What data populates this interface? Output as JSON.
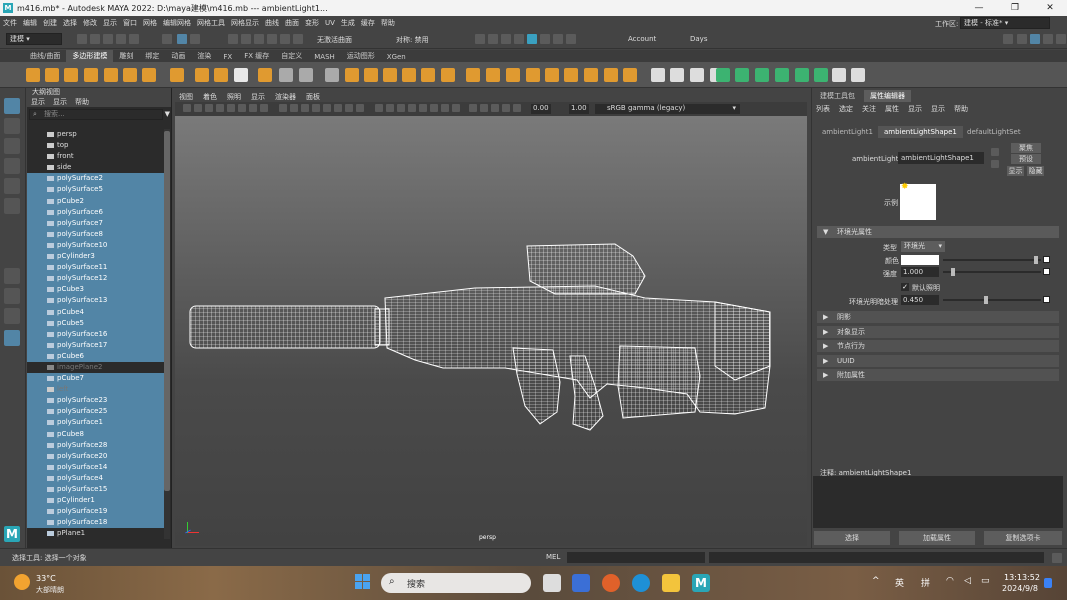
{
  "window": {
    "title": "m416.mb* - Autodesk MAYA 2022: D:\\maya建模\\m416.mb   ---   ambientLight1...",
    "minimize": "—",
    "maximize": "❐",
    "close": "✕"
  },
  "menubar": [
    "文件",
    "编辑",
    "创建",
    "选择",
    "修改",
    "显示",
    "窗口",
    "网格",
    "编辑网格",
    "网格工具",
    "网格显示",
    "曲线",
    "曲面",
    "变形",
    "UV",
    "生成",
    "缓存",
    "帮助"
  ],
  "workspace": {
    "label": "工作区:",
    "value": "建模 - 标准*"
  },
  "statusline": {
    "mode": "建模",
    "no_live_surface": "无激活曲面",
    "symmetry": "对称: 禁用",
    "account": "Account",
    "days": "Days"
  },
  "shelf_tabs": [
    "曲线/曲面",
    "多边形建模",
    "雕刻",
    "绑定",
    "动画",
    "渲染",
    "FX",
    "FX 缓存",
    "自定义",
    "MASH",
    "运动图形",
    "XGen"
  ],
  "shelf_active": 1,
  "outliner": {
    "title": "大纲视图",
    "menus": [
      "显示",
      "显示",
      "帮助"
    ],
    "search_placeholder": "搜索...",
    "items": [
      {
        "name": "persp",
        "kind": "camera",
        "state": "normal"
      },
      {
        "name": "top",
        "kind": "camera",
        "state": "normal"
      },
      {
        "name": "front",
        "kind": "camera",
        "state": "normal"
      },
      {
        "name": "side",
        "kind": "camera",
        "state": "normal"
      },
      {
        "name": "polySurface2",
        "kind": "mesh",
        "state": "sel"
      },
      {
        "name": "polySurface5",
        "kind": "mesh",
        "state": "sel"
      },
      {
        "name": "pCube2",
        "kind": "mesh",
        "state": "sel"
      },
      {
        "name": "polySurface6",
        "kind": "mesh",
        "state": "sel"
      },
      {
        "name": "polySurface7",
        "kind": "mesh",
        "state": "sel"
      },
      {
        "name": "polySurface8",
        "kind": "mesh",
        "state": "sel"
      },
      {
        "name": "polySurface10",
        "kind": "mesh",
        "state": "sel"
      },
      {
        "name": "pCylinder3",
        "kind": "mesh",
        "state": "sel"
      },
      {
        "name": "polySurface11",
        "kind": "mesh",
        "state": "sel"
      },
      {
        "name": "polySurface12",
        "kind": "mesh",
        "state": "sel"
      },
      {
        "name": "pCube3",
        "kind": "mesh",
        "state": "sel"
      },
      {
        "name": "polySurface13",
        "kind": "mesh",
        "state": "sel"
      },
      {
        "name": "pCube4",
        "kind": "mesh",
        "state": "sel"
      },
      {
        "name": "pCube5",
        "kind": "mesh",
        "state": "sel"
      },
      {
        "name": "polySurface16",
        "kind": "mesh",
        "state": "sel"
      },
      {
        "name": "polySurface17",
        "kind": "mesh",
        "state": "sel"
      },
      {
        "name": "pCube6",
        "kind": "mesh",
        "state": "sel"
      },
      {
        "name": "imagePlane2",
        "kind": "image",
        "state": "dim"
      },
      {
        "name": "pCube7",
        "kind": "mesh",
        "state": "selsoft"
      },
      {
        "name": "left",
        "kind": "camera",
        "state": "dimsel"
      },
      {
        "name": "polySurface23",
        "kind": "mesh",
        "state": "sel"
      },
      {
        "name": "polySurface25",
        "kind": "mesh",
        "state": "sel"
      },
      {
        "name": "polySurface1",
        "kind": "mesh",
        "state": "sel"
      },
      {
        "name": "pCube8",
        "kind": "mesh",
        "state": "sel"
      },
      {
        "name": "polySurface28",
        "kind": "mesh",
        "state": "sel"
      },
      {
        "name": "polySurface20",
        "kind": "mesh",
        "state": "sel"
      },
      {
        "name": "polySurface14",
        "kind": "mesh",
        "state": "sel"
      },
      {
        "name": "polySurface4",
        "kind": "mesh",
        "state": "sel"
      },
      {
        "name": "polySurface15",
        "kind": "mesh",
        "state": "sel"
      },
      {
        "name": "pCylinder1",
        "kind": "mesh",
        "state": "sel"
      },
      {
        "name": "polySurface19",
        "kind": "mesh",
        "state": "sel"
      },
      {
        "name": "polySurface18",
        "kind": "mesh",
        "state": "sel"
      },
      {
        "name": "pPlane1",
        "kind": "mesh",
        "state": "normal"
      }
    ]
  },
  "viewport": {
    "menus": [
      "视图",
      "着色",
      "照明",
      "显示",
      "渲染器",
      "面板"
    ],
    "exposure": "0.00",
    "gamma": "1.00",
    "colorspace": "sRGB gamma (legacy)",
    "camera_label": "persp"
  },
  "attribute_editor": {
    "tabs": [
      "建模工具包",
      "属性编辑器"
    ],
    "active_tab": 1,
    "menus": [
      "列表",
      "选定",
      "关注",
      "属性",
      "显示",
      "显示",
      "帮助"
    ],
    "node_tabs": [
      "ambientLight1",
      "ambientLightShape1",
      "defaultLightSet"
    ],
    "active_node": 1,
    "node_label": "ambientLight:",
    "node_value": "ambientLightShape1",
    "focus_btn": "聚焦",
    "preset_btn": "预设",
    "show_btn": "显示",
    "hide_btn": "隐藏",
    "sample_label": "示例",
    "section_main": "环境光属性",
    "type_label": "类型",
    "type_value": "环境光",
    "color_label": "颜色",
    "intensity_label": "强度",
    "intensity_value": "1.000",
    "default_lighting": "默认照明",
    "ambient_shade_label": "环境光明暗处理",
    "ambient_shade_value": "0.450",
    "sections": [
      "阴影",
      "对象显示",
      "节点行为",
      "UUID",
      "附加属性"
    ],
    "notes_label": "注释: ambientLightShape1",
    "bottom_buttons": [
      "选择",
      "加载属性",
      "复制选项卡"
    ]
  },
  "helpline": {
    "text": "选择工具: 选择一个对象",
    "mel": "MEL"
  },
  "taskbar": {
    "temp": "33°C",
    "weather": "大部晴朗",
    "search": "搜索",
    "ime1": "英",
    "ime2": "拼",
    "time": "13:13:52",
    "date": "2024/9/8"
  },
  "colors": {
    "selection": "#5285a6",
    "panel": "#444444",
    "dark": "#2b2b2b"
  }
}
